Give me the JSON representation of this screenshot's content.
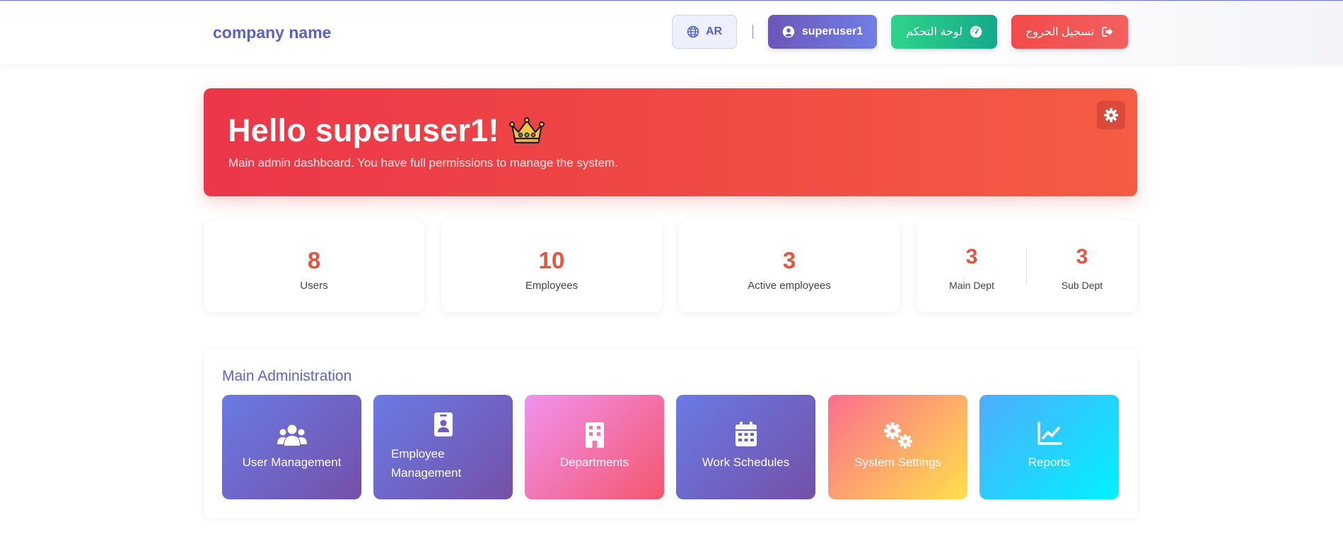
{
  "header": {
    "brand": "company name",
    "lang_label": "AR",
    "user_label": "superuser1",
    "dashboard_label": "لوحة التحكم",
    "logout_label": "تسجيل الخروج"
  },
  "hero": {
    "title": "Hello superuser1!",
    "subtitle": "Main admin dashboard. You have full permissions to manage the system."
  },
  "stats": [
    {
      "value": "8",
      "label": "Users"
    },
    {
      "value": "10",
      "label": "Employees"
    },
    {
      "value": "3",
      "label": "Active employees"
    }
  ],
  "dept_stats": {
    "main": {
      "value": "3",
      "label": "Main Dept"
    },
    "sub": {
      "value": "3",
      "label": "Sub Dept"
    }
  },
  "admin": {
    "title": "Main Administration",
    "tiles": [
      {
        "label": "User Management",
        "icon": "users-icon"
      },
      {
        "label": "Employee Management",
        "icon": "id-badge-icon"
      },
      {
        "label": "Departments",
        "icon": "building-icon"
      },
      {
        "label": "Work Schedules",
        "icon": "calendar-icon"
      },
      {
        "label": "System Settings",
        "icon": "cogs-icon"
      },
      {
        "label": "Reports",
        "icon": "chart-line-icon"
      }
    ]
  },
  "colors": {
    "brand": "#5a63c4",
    "hero_start": "#ec3649",
    "hero_end": "#f45c43",
    "stat_value": "#e4553f"
  }
}
